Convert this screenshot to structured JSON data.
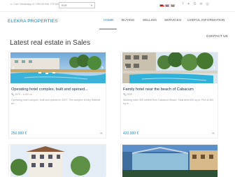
{
  "topbar": {
    "info": "☏ Call / WhatsApp   ✉  +359 89 845 777 000",
    "currency": "EUR",
    "social_icons": [
      "facebook-icon",
      "twitter-icon",
      "google-plus-icon",
      "linkedin-icon",
      "instagram-icon"
    ]
  },
  "logo": {
    "part1": "ELEKRA",
    "part2": " PROPERTIES"
  },
  "nav": {
    "home": "HOME",
    "buying": "BUYING",
    "selling": "SELLING",
    "services": "SERVICES",
    "useful": "USEFUL INFORMATION",
    "contact": "CONTACT US"
  },
  "section": {
    "title": "Latest real estate in Sales"
  },
  "listings": [
    {
      "title": "Operating hotel complex, built and opened...",
      "meta": "🔍 3579  ⌂ 4,000 m²",
      "desc": "Operating hotel complex, built and opened in 2007. The complex is fully finished an...",
      "price": "250,000 €"
    },
    {
      "title": "Family hotel near the beach of Cabacum",
      "meta": "🔍 2809",
      "desc": "Working hotel 300 meters from Cabacum Beach. Total area 600 sq.m. Plot of 400 sq.m...",
      "price": "420,000 €"
    }
  ],
  "colors": {
    "accent": "#1e88b6",
    "text": "#333333",
    "muted": "#9a9a9a"
  }
}
